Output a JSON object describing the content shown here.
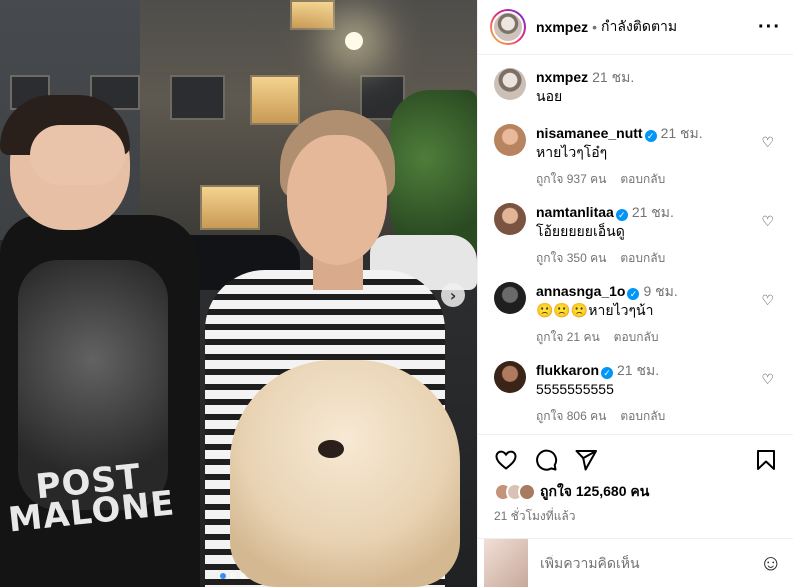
{
  "post": {
    "author": "nxmpez",
    "follow_status": "กำลังติดตาม",
    "separator": "•",
    "more_label": "···",
    "caption": {
      "username": "nxmpez",
      "time": "21 ชม.",
      "text": "นอย"
    },
    "image_print_text": "POST MALONE",
    "next_label": "›"
  },
  "comments": [
    {
      "username": "nisamanee_nutt",
      "verified": true,
      "time": "21 ชม.",
      "text": "หายไวๆโอ๋ๆ",
      "likes": "ถูกใจ 937 คน",
      "reply": "ตอบกลับ",
      "avatar_color": "#b7845f"
    },
    {
      "username": "namtanlitaa",
      "verified": true,
      "time": "21 ชม.",
      "text": "โอ้ยยยยยเอ็นดู",
      "likes": "ถูกใจ 350 คน",
      "reply": "ตอบกลับ",
      "avatar_color": "#a77a62"
    },
    {
      "username": "annasnga_1o",
      "verified": true,
      "time": "9 ชม.",
      "text": "🙁🙁🙁หายไวๆน้า",
      "likes": "ถูกใจ 21 คน",
      "reply": "ตอบกลับ",
      "avatar_color": "#2f2f2f"
    },
    {
      "username": "flukkaron",
      "verified": true,
      "time": "21 ชม.",
      "text": "5555555555",
      "likes": "ถูกใจ 806 คน",
      "reply": "ตอบกลับ",
      "avatar_color": "#5e3a2c"
    }
  ],
  "actions": {
    "likes_text": "ถูกใจ 125,680 คน",
    "posted_ago": "21 ชั่วโมงที่แล้ว"
  },
  "add_comment": {
    "placeholder": "เพิ่มความคิดเห็น",
    "emoji_label": "☺"
  },
  "colors": {
    "link": "#0095f6",
    "muted": "#737373",
    "carousel_active": "#3b8cf5"
  },
  "icons": [
    "heart-icon",
    "comment-icon",
    "share-icon",
    "bookmark-icon",
    "verified-badge-icon",
    "emoji-icon",
    "chevron-right-icon"
  ]
}
